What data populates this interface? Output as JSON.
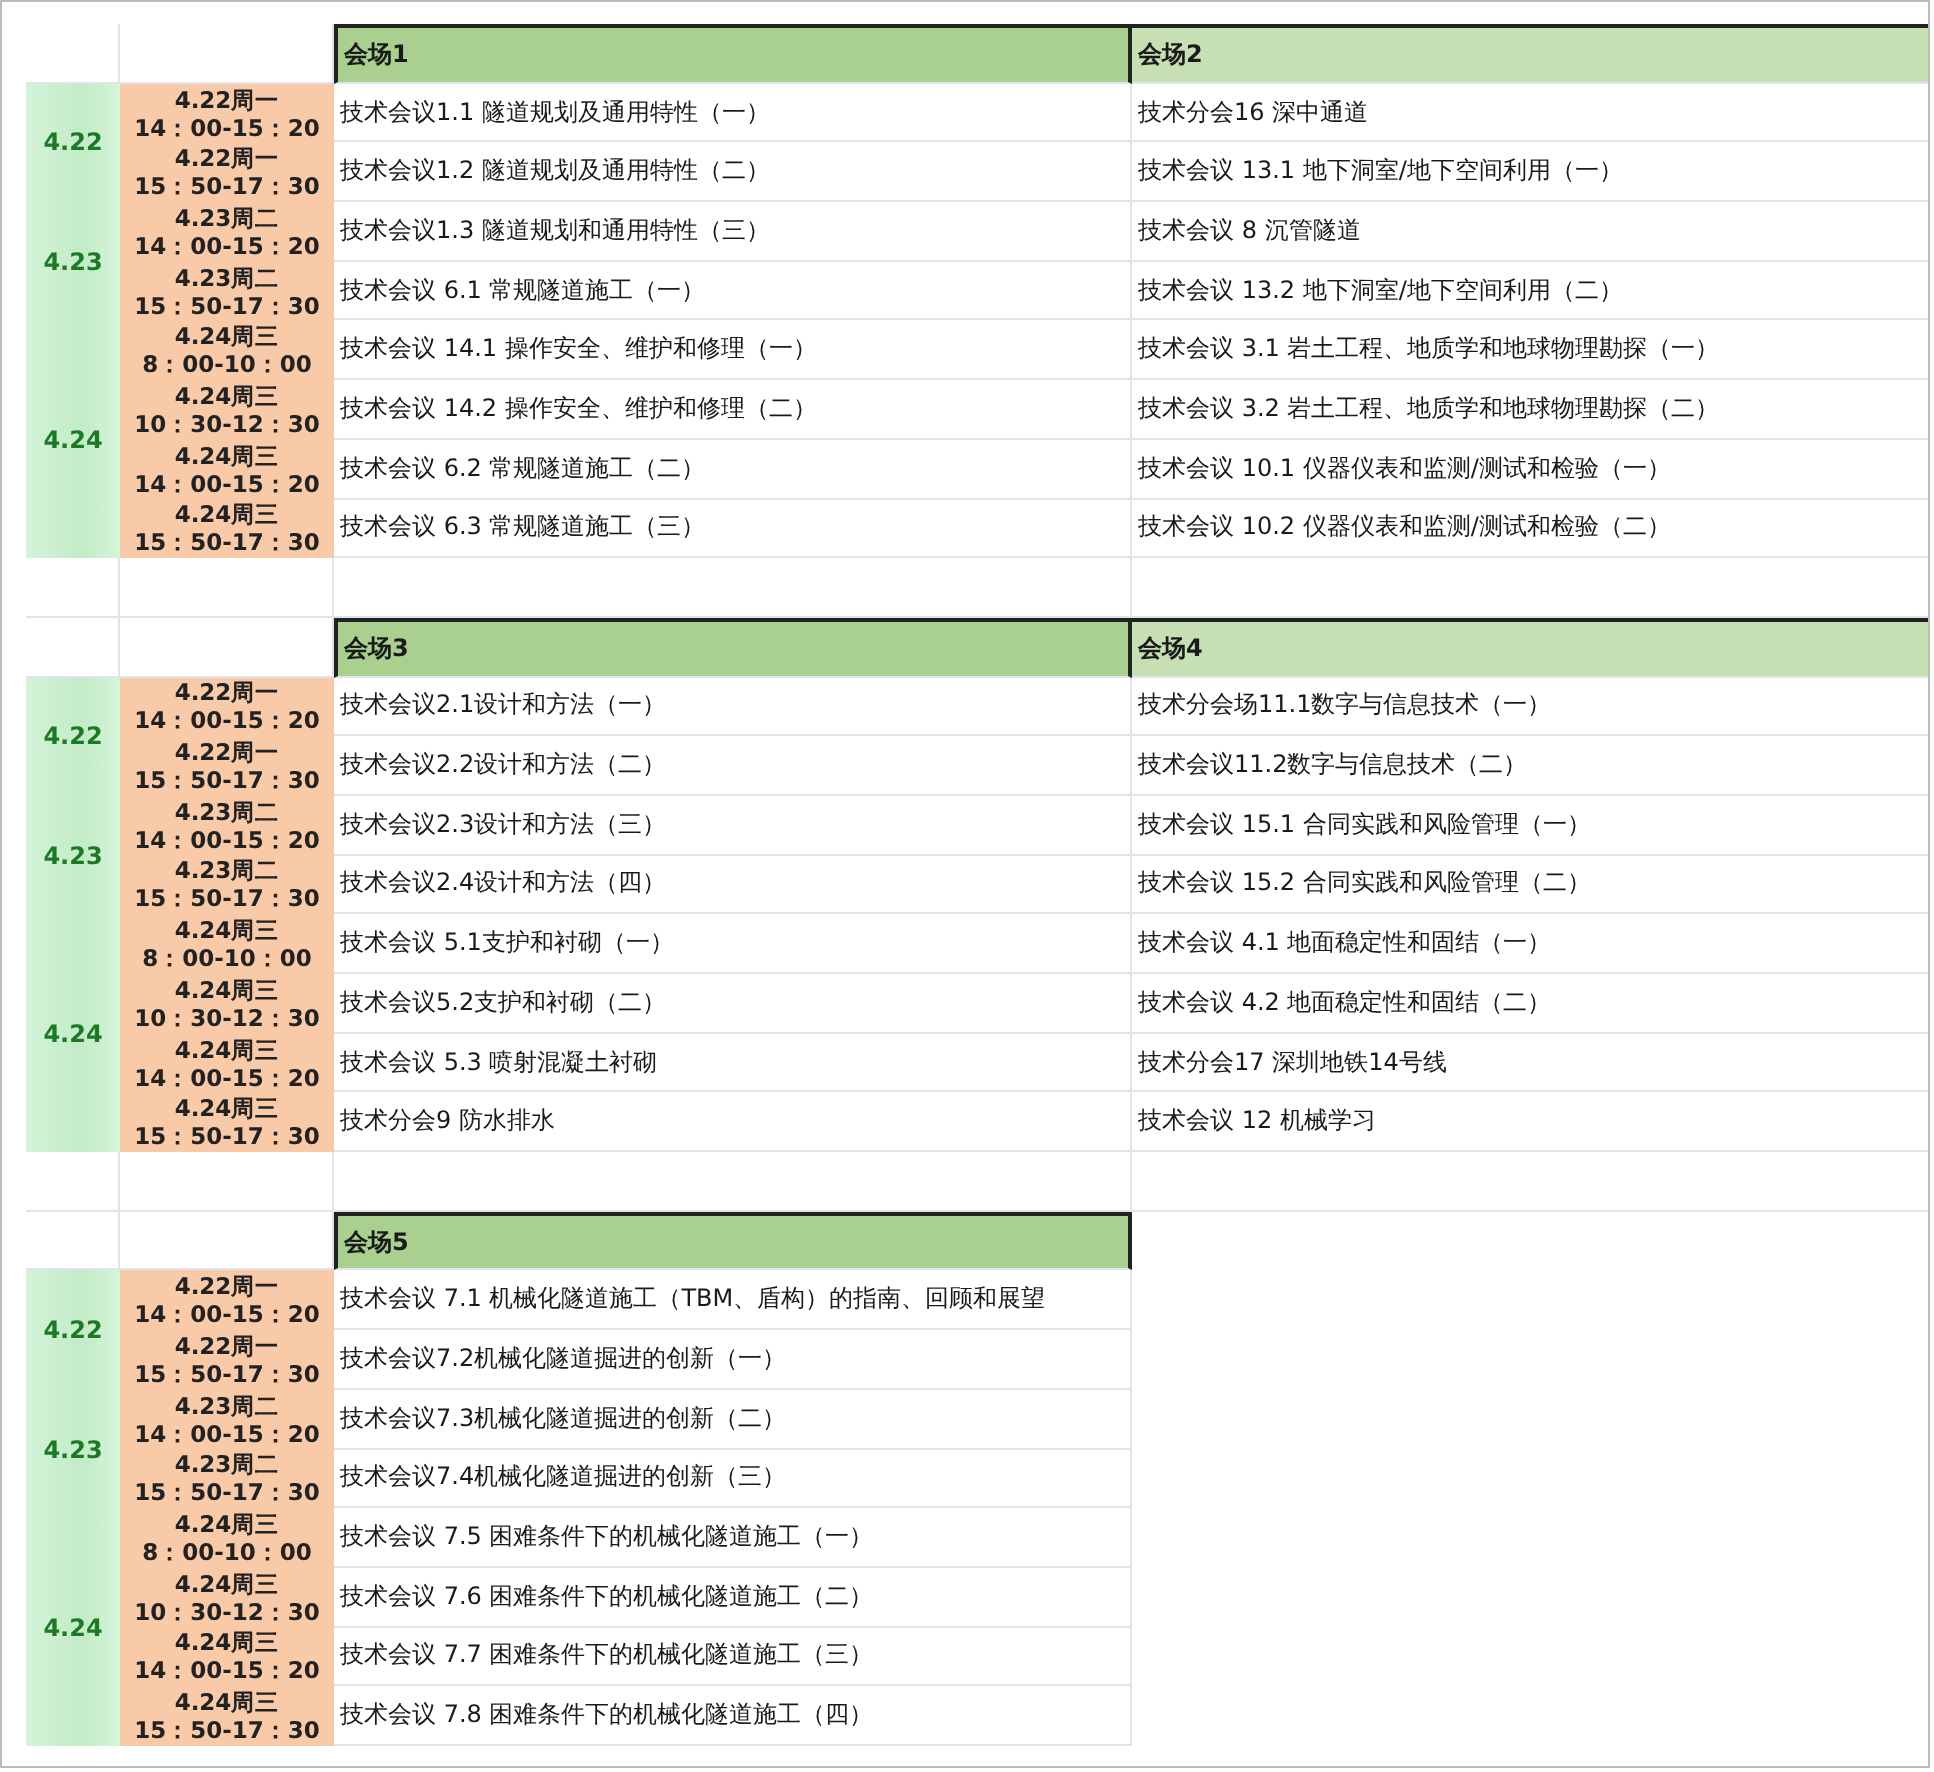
{
  "blocks": [
    {
      "venues": [
        {
          "name": "会场1",
          "sessions": [
            "技术会议1.1 隧道规划及通用特性（一）",
            "技术会议1.2 隧道规划及通用特性（二）",
            "技术会议1.3 隧道规划和通用特性（三）",
            "技术会议 6.1 常规隧道施工（一）",
            "技术会议 14.1 操作安全、维护和修理（一）",
            "技术会议 14.2 操作安全、维护和修理（二）",
            "技术会议 6.2 常规隧道施工（二）",
            "技术会议 6.3 常规隧道施工（三）"
          ]
        },
        {
          "name": "会场2",
          "sessions": [
            "技术分会16 深中通道",
            "技术会议 13.1 地下洞室/地下空间利用（一）",
            "技术会议 8 沉管隧道",
            "技术会议 13.2 地下洞室/地下空间利用（二）",
            "技术会议 3.1 岩土工程、地质学和地球物理勘探（一）",
            "技术会议 3.2 岩土工程、地质学和地球物理勘探（二）",
            "技术会议 10.1 仪器仪表和监测/测试和检验（一）",
            "技术会议 10.2 仪器仪表和监测/测试和检验（二）"
          ]
        }
      ],
      "days": [
        {
          "date": "4.22",
          "slots": [
            {
              "day": "4.22周一",
              "time": "14：00-15：20"
            },
            {
              "day": "4.22周一",
              "time": "15：50-17：30"
            }
          ]
        },
        {
          "date": "4.23",
          "slots": [
            {
              "day": "4.23周二",
              "time": "14：00-15：20"
            },
            {
              "day": "4.23周二",
              "time": "15：50-17：30"
            }
          ]
        },
        {
          "date": "4.24",
          "slots": [
            {
              "day": "4.24周三",
              "time": "8：00-10：00"
            },
            {
              "day": "4.24周三",
              "time": "10：30-12：30"
            },
            {
              "day": "4.24周三",
              "time": "14：00-15：20"
            },
            {
              "day": "4.24周三",
              "time": "15：50-17：30"
            }
          ]
        }
      ]
    },
    {
      "venues": [
        {
          "name": "会场3",
          "sessions": [
            "技术会议2.1设计和方法（一）",
            "技术会议2.2设计和方法（二）",
            "技术会议2.3设计和方法（三）",
            "技术会议2.4设计和方法（四）",
            "技术会议 5.1支护和衬砌（一）",
            "技术会议5.2支护和衬砌（二）",
            "技术会议 5.3 喷射混凝土衬砌",
            "技术分会9 防水排水"
          ]
        },
        {
          "name": "会场4",
          "sessions": [
            "技术分会场11.1数字与信息技术（一）",
            "技术会议11.2数字与信息技术（二）",
            "技术会议 15.1 合同实践和风险管理（一）",
            "技术会议 15.2 合同实践和风险管理（二）",
            "技术会议 4.1 地面稳定性和固结（一）",
            "技术会议 4.2 地面稳定性和固结（二）",
            "技术分会17 深圳地铁14号线",
            "技术会议 12 机械学习"
          ]
        }
      ],
      "days": [
        {
          "date": "4.22",
          "slots": [
            {
              "day": "4.22周一",
              "time": "14：00-15：20"
            },
            {
              "day": "4.22周一",
              "time": "15：50-17：30"
            }
          ]
        },
        {
          "date": "4.23",
          "slots": [
            {
              "day": "4.23周二",
              "time": "14：00-15：20"
            },
            {
              "day": "4.23周二",
              "time": "15：50-17：30"
            }
          ]
        },
        {
          "date": "4.24",
          "slots": [
            {
              "day": "4.24周三",
              "time": "8：00-10：00"
            },
            {
              "day": "4.24周三",
              "time": "10：30-12：30"
            },
            {
              "day": "4.24周三",
              "time": "14：00-15：20"
            },
            {
              "day": "4.24周三",
              "time": "15：50-17：30"
            }
          ]
        }
      ]
    },
    {
      "venues": [
        {
          "name": "会场5",
          "sessions": [
            "技术会议 7.1 机械化隧道施工（TBM、盾构）的指南、回顾和展望",
            "技术会议7.2机械化隧道掘进的创新（一）",
            "技术会议7.3机械化隧道掘进的创新（二）",
            "技术会议7.4机械化隧道掘进的创新（三）",
            "技术会议 7.5 困难条件下的机械化隧道施工（一）",
            "技术会议 7.6 困难条件下的机械化隧道施工（二）",
            "技术会议 7.7 困难条件下的机械化隧道施工（三）",
            "技术会议 7.8 困难条件下的机械化隧道施工（四）"
          ]
        }
      ],
      "days": [
        {
          "date": "4.22",
          "slots": [
            {
              "day": "4.22周一",
              "time": "14：00-15：20"
            },
            {
              "day": "4.22周一",
              "time": "15：50-17：30"
            }
          ]
        },
        {
          "date": "4.23",
          "slots": [
            {
              "day": "4.23周二",
              "time": "14：00-15：20"
            },
            {
              "day": "4.23周二",
              "time": "15：50-17：30"
            }
          ]
        },
        {
          "date": "4.24",
          "slots": [
            {
              "day": "4.24周三",
              "time": "8：00-10：00"
            },
            {
              "day": "4.24周三",
              "time": "10：30-12：30"
            },
            {
              "day": "4.24周三",
              "time": "14：00-15：20"
            },
            {
              "day": "4.24周三",
              "time": "15：50-17：30"
            }
          ]
        }
      ]
    }
  ]
}
